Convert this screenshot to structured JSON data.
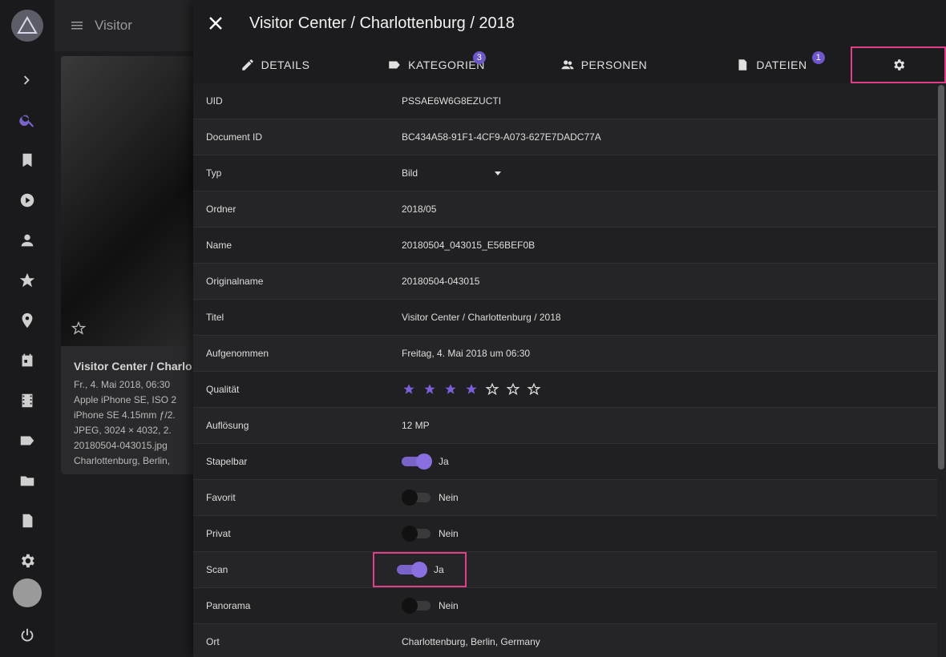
{
  "bg_header": {
    "title": "Visitor"
  },
  "bg_card": {
    "title": "Visitor Center / Charlo",
    "lines": [
      "Fr., 4. Mai 2018, 06:30",
      "Apple iPhone SE, ISO 2",
      "iPhone SE 4.15mm ƒ/2.",
      "JPEG, 3024 × 4032, 2.",
      "20180504-043015.jpg",
      "Charlottenburg, Berlin,"
    ]
  },
  "dialog": {
    "title": "Visitor Center / Charlottenburg / 2018"
  },
  "tabs": [
    {
      "label": "DETAILS",
      "icon": "pencil-icon"
    },
    {
      "label": "KATEGORIEN",
      "icon": "label-icon",
      "badge": "3"
    },
    {
      "label": "PERSONEN",
      "icon": "people-icon"
    },
    {
      "label": "DATEIEN",
      "icon": "file-icon",
      "badge": "1"
    },
    {
      "label": "",
      "icon": "gear-icon"
    }
  ],
  "rows": {
    "uid": {
      "key": "UID",
      "value": "PSSAE6W6G8EZUCTI"
    },
    "document_id": {
      "key": "Document ID",
      "value": "BC434A58-91F1-4CF9-A073-627E7DADC77A"
    },
    "typ": {
      "key": "Typ",
      "value": "Bild"
    },
    "ordner": {
      "key": "Ordner",
      "value": "2018/05"
    },
    "name": {
      "key": "Name",
      "value": "20180504_043015_E56BEF0B"
    },
    "originalname": {
      "key": "Originalname",
      "value": "20180504-043015"
    },
    "titel": {
      "key": "Titel",
      "value": "Visitor Center / Charlottenburg / 2018"
    },
    "aufgenommen": {
      "key": "Aufgenommen",
      "value": "Freitag, 4. Mai 2018 um 06:30"
    },
    "qualitaet": {
      "key": "Qualität",
      "rating": 4,
      "max": 7
    },
    "aufloesung": {
      "key": "Auflösung",
      "value": "12 MP"
    },
    "stapelbar": {
      "key": "Stapelbar",
      "value": "Ja",
      "on": true
    },
    "favorit": {
      "key": "Favorit",
      "value": "Nein",
      "on": false
    },
    "privat": {
      "key": "Privat",
      "value": "Nein",
      "on": false
    },
    "scan": {
      "key": "Scan",
      "value": "Ja",
      "on": true
    },
    "panorama": {
      "key": "Panorama",
      "value": "Nein",
      "on": false
    },
    "ort": {
      "key": "Ort",
      "value": "Charlottenburg, Berlin, Germany"
    }
  },
  "colors": {
    "accent": "#7a63c8",
    "highlight": "#e0408a",
    "star": "#7d5fdc"
  }
}
